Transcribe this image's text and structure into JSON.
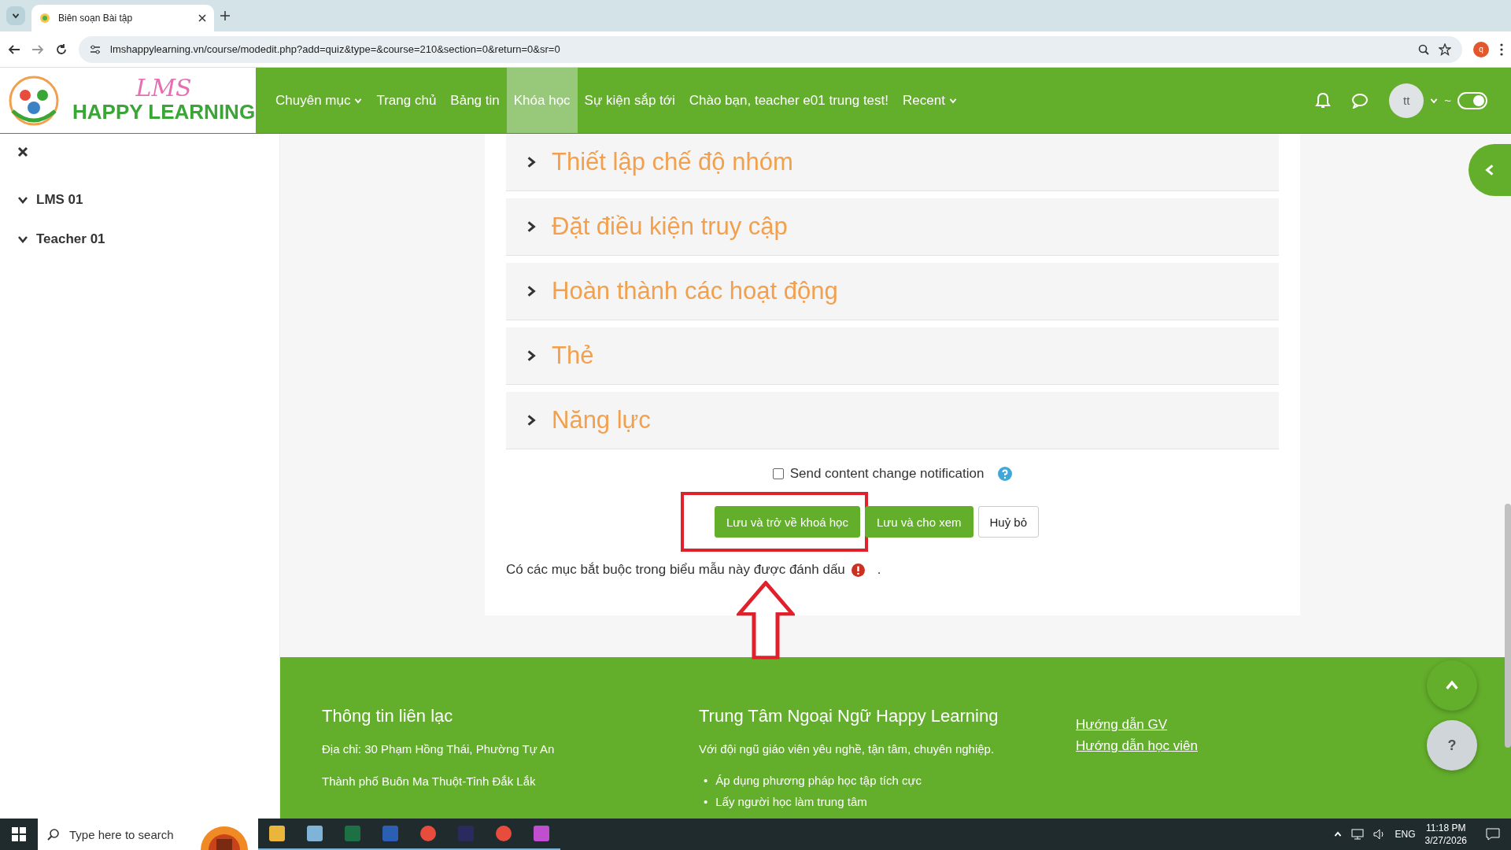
{
  "browser": {
    "tab_title": "Biên soạn Bài tập",
    "url": "lmshappylearning.vn/course/modedit.php?add=quiz&type=&course=210&section=0&return=0&sr=0",
    "profile_initial": "q"
  },
  "logo": {
    "script": "LMS",
    "name": "HAPPY LEARNING"
  },
  "nav": [
    {
      "label": "Chuyên mục",
      "dropdown": true,
      "selected": false
    },
    {
      "label": "Trang chủ",
      "dropdown": false,
      "selected": false
    },
    {
      "label": "Bảng tin",
      "dropdown": false,
      "selected": false
    },
    {
      "label": "Khóa học",
      "dropdown": false,
      "selected": true
    },
    {
      "label": "Sự kiện sắp tới",
      "dropdown": false,
      "selected": false
    },
    {
      "label": "Chào bạn, teacher e01 trung test!",
      "dropdown": false,
      "selected": false
    },
    {
      "label": "Recent",
      "dropdown": true,
      "selected": false
    }
  ],
  "user": {
    "avatar": "tt",
    "suffix": "~",
    "dark_mode": true
  },
  "sidebar": {
    "items": [
      {
        "label": "LMS 01",
        "expanded": true
      },
      {
        "label": "Teacher 01",
        "expanded": true
      }
    ]
  },
  "sections": [
    {
      "title": "Thiết lập chế độ nhóm",
      "expanded": false
    },
    {
      "title": "Đặt điều kiện truy cập",
      "expanded": false
    },
    {
      "title": "Hoàn thành các hoạt động",
      "expanded": false
    },
    {
      "title": "Thẻ",
      "expanded": false
    },
    {
      "title": "Năng lực",
      "expanded": false
    }
  ],
  "notification": {
    "label": "Send content change notification",
    "checked": false
  },
  "buttons": [
    {
      "label": "Lưu và trở về khoá học",
      "kind": "primary",
      "highlighted": true
    },
    {
      "label": "Lưu và cho xem",
      "kind": "primary",
      "highlighted": false
    },
    {
      "label": "Huỷ bỏ",
      "kind": "secondary",
      "highlighted": false
    }
  ],
  "required_note": {
    "text": "Có các mục bắt buộc trong biểu mẫu này được đánh dấu",
    "end": "."
  },
  "footer": {
    "contact": {
      "title": "Thông tin liên lạc",
      "lines": [
        "Địa chỉ: 30 Phạm Hồng Thái, Phường Tự An",
        "Thành phố Buôn Ma Thuột-Tỉnh Đắk Lắk"
      ]
    },
    "center": {
      "title": "Trung Tâm Ngoại Ngữ Happy Learning",
      "text": "Với đội ngũ giáo viên yêu nghề, tận tâm, chuyên nghiệp.",
      "marker": "•",
      "bullets": [
        "Áp dụng phương pháp học tập tích cực",
        "Lấy người học làm trung tâm"
      ]
    },
    "links": [
      "Hướng dẫn GV",
      "Hướng dẫn học viên"
    ],
    "help": "?"
  },
  "taskbar": {
    "search_placeholder": "Type here to search",
    "language": "ENG",
    "time": "11:18 PM",
    "date": "3/27/2026"
  }
}
